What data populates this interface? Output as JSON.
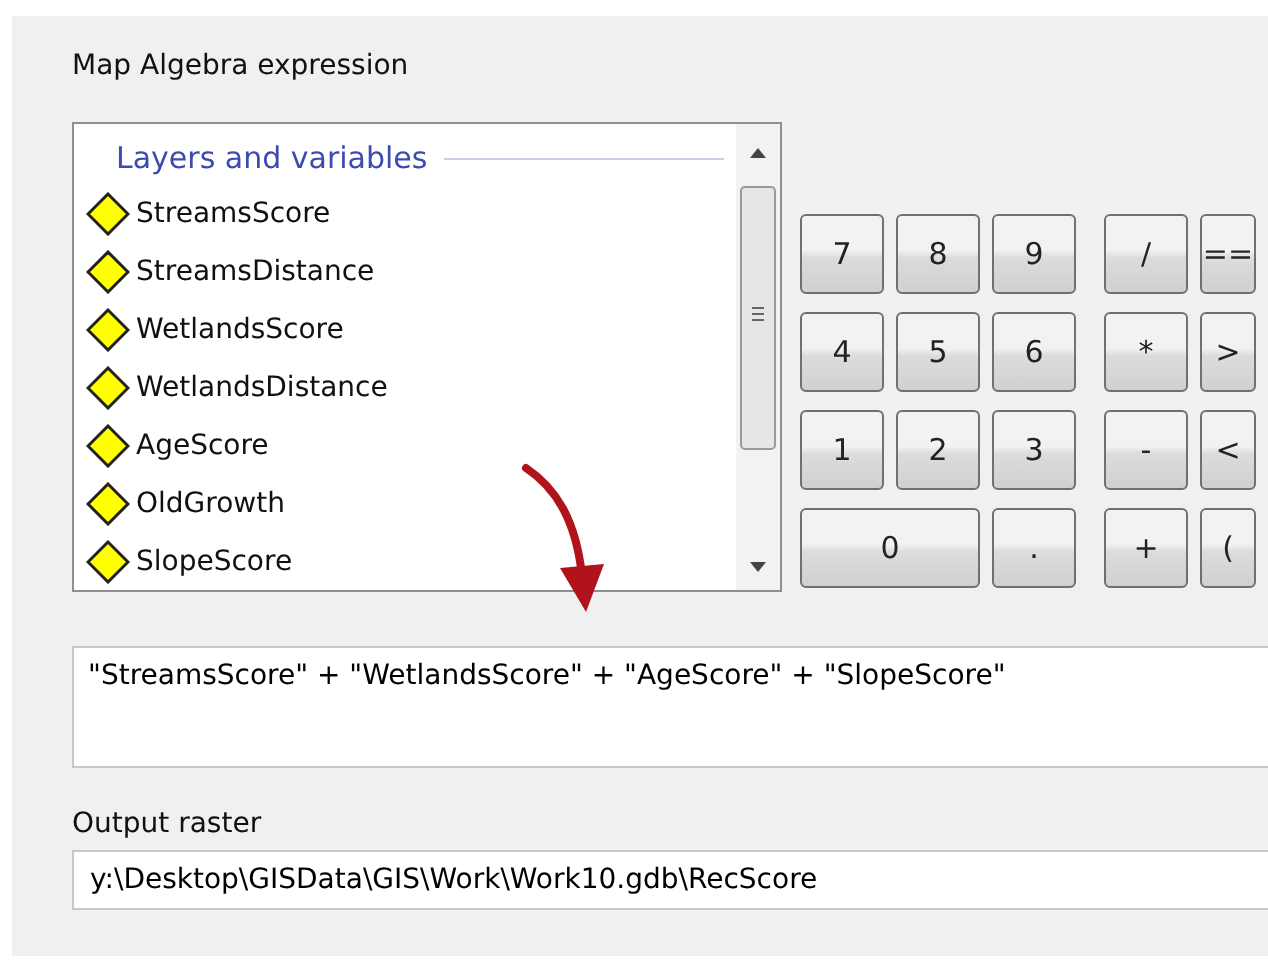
{
  "expression_label": "Map Algebra expression",
  "layers": {
    "header": "Layers and variables",
    "items": [
      {
        "name": "StreamsScore"
      },
      {
        "name": "StreamsDistance"
      },
      {
        "name": "WetlandsScore"
      },
      {
        "name": "WetlandsDistance"
      },
      {
        "name": "AgeScore"
      },
      {
        "name": "OldGrowth"
      },
      {
        "name": "SlopeScore"
      }
    ]
  },
  "keypad": [
    {
      "label": "7",
      "kind": "digit"
    },
    {
      "label": "8",
      "kind": "digit"
    },
    {
      "label": "9",
      "kind": "digit"
    },
    {
      "label": "/",
      "kind": "operator"
    },
    {
      "label": "==",
      "kind": "operator"
    },
    {
      "label": "4",
      "kind": "digit"
    },
    {
      "label": "5",
      "kind": "digit"
    },
    {
      "label": "6",
      "kind": "digit"
    },
    {
      "label": "*",
      "kind": "operator"
    },
    {
      "label": ">",
      "kind": "operator"
    },
    {
      "label": "1",
      "kind": "digit"
    },
    {
      "label": "2",
      "kind": "digit"
    },
    {
      "label": "3",
      "kind": "digit"
    },
    {
      "label": "-",
      "kind": "operator"
    },
    {
      "label": "<",
      "kind": "operator"
    },
    {
      "label": "0",
      "kind": "wide"
    },
    {
      "label": ".",
      "kind": "digit"
    },
    {
      "label": "+",
      "kind": "operator"
    },
    {
      "label": "(",
      "kind": "operator"
    }
  ],
  "expression": "\"StreamsScore\" + \"WetlandsScore\" + \"AgeScore\" + \"SlopeScore\"",
  "output": {
    "label": "Output raster",
    "value": "y:\\Desktop\\GISData\\GIS\\Work\\Work10.gdb\\RecScore"
  }
}
